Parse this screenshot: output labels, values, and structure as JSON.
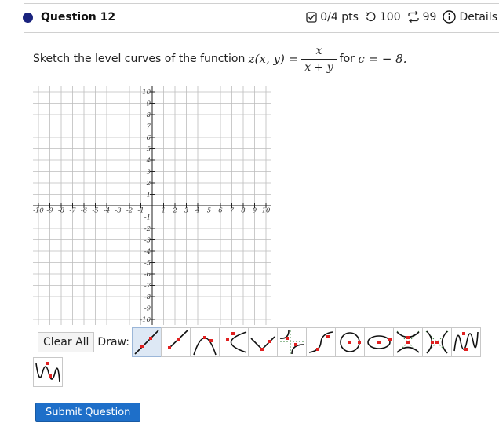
{
  "header": {
    "question_title": "Question 12",
    "points": "0/4 pts",
    "attempts": "100",
    "retries": "99",
    "details": "Details"
  },
  "prompt": {
    "before": "Sketch the level curves of the function",
    "function_lhs": "z(x, y) =",
    "numerator": "x",
    "denominator": "x + y",
    "middle": "for",
    "c_expr": "c = − 8."
  },
  "graph": {
    "x_min": -10,
    "x_max": 10,
    "y_min": -10,
    "y_max": 10,
    "x_ticks": [
      "-10",
      "-9",
      "-8",
      "-7",
      "-6",
      "-5",
      "-4",
      "-3",
      "-2",
      "-1",
      "1",
      "2",
      "3",
      "4",
      "5",
      "6",
      "7",
      "8",
      "9",
      "10"
    ],
    "y_ticks": [
      "10",
      "9",
      "8",
      "7",
      "6",
      "5",
      "4",
      "3",
      "2",
      "1",
      "-1",
      "-2",
      "-3",
      "-4",
      "-5",
      "-6",
      "-7",
      "-8",
      "-9",
      "-10"
    ]
  },
  "toolbar": {
    "clear_label": "Clear All",
    "draw_label": "Draw:",
    "tools": [
      "line-tool-icon",
      "ray-tool-icon",
      "parabola-tool-icon",
      "horizontal-parabola-tool-icon",
      "absolute-value-tool-icon",
      "rational-tool-icon",
      "cubic-tool-icon",
      "circle-tool-icon",
      "ellipse-tool-icon",
      "vertical-hyperbola-tool-icon",
      "horizontal-hyperbola-tool-icon",
      "sine-tool-icon",
      "cosine-tool-icon"
    ],
    "selected_tool": "line-tool-icon"
  },
  "submit": {
    "label": "Submit Question"
  },
  "colors": {
    "accent": "#1e6fc9",
    "dot": "#1a237e",
    "point": "#e02020",
    "grid": "#bdbdbd"
  }
}
